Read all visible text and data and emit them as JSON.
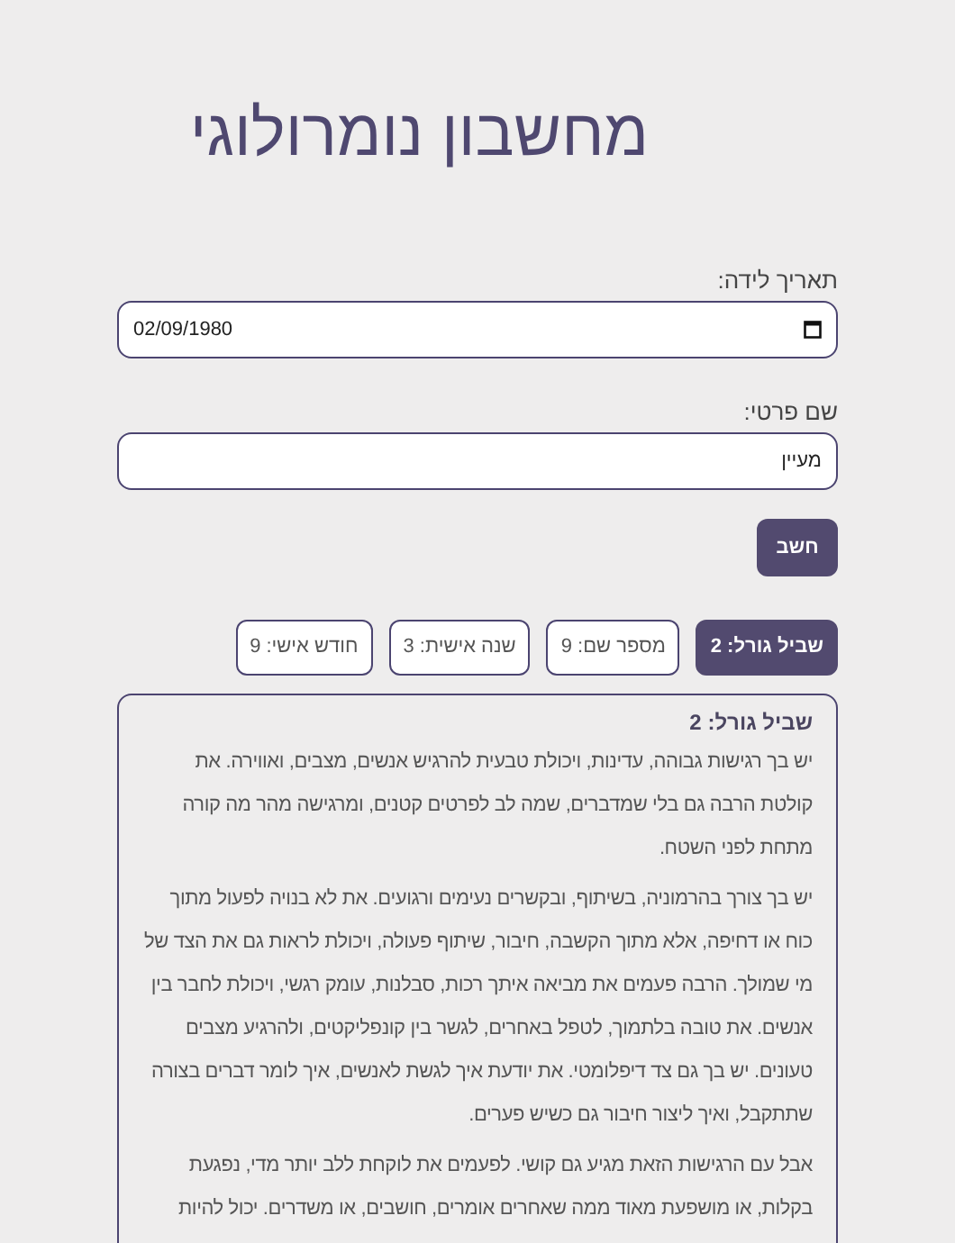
{
  "title": "מחשבון נומרולוגי",
  "fields": [
    {
      "kind": "date",
      "label": "תאריך לידה:",
      "value": "02/09/1980"
    },
    {
      "kind": "text",
      "label": "שם פרטי:",
      "value": "מעיין"
    }
  ],
  "button": "חשב",
  "tabs": [
    {
      "label": "שביל גורל: 2",
      "selected": true
    },
    {
      "label": "מספר שם: 9",
      "selected": false
    },
    {
      "label": "שנה אישית: 3",
      "selected": false
    },
    {
      "label": "חודש אישי: 9",
      "selected": false
    }
  ],
  "result": {
    "heading": "שביל גורל: 2",
    "paragraphs": [
      "יש בך רגישות גבוהה, עדינות, ויכולת טבעית להרגיש אנשים, מצבים, ואווירה. את קולטת הרבה גם בלי שמדברים, שמה לב לפרטים קטנים, ומרגישה מהר מה קורה מתחת לפני השטח.",
      "יש בך צורך בהרמוניה, בשיתוף, ובקשרים נעימים ורגועים. את לא בנויה לפעול מתוך כוח או דחיפה, אלא מתוך הקשבה, חיבור, שיתוף פעולה, ויכולת לראות גם את הצד של מי שמולך. הרבה פעמים את מביאה איתך רכות, סבלנות, עומק רגשי, ויכולת לחבר בין אנשים. את טובה בלתמוך, לטפל באחרים, לגשר בין קונפליקטים, ולהרגיע מצבים טעונים. יש בך גם צד דיפלומטי. את יודעת איך לגשת לאנשים, איך לומר דברים בצורה שתתקבל, ואיך ליצור חיבור גם כשיש פערים.",
      "אבל עם הרגישות הזאת מגיע גם קושי. לפעמים את לוקחת ללב יותר מדי, נפגעת בקלות, או מושפעת מאוד ממה שאחרים אומרים, חושבים, או משדרים. יכול להיות"
    ]
  }
}
